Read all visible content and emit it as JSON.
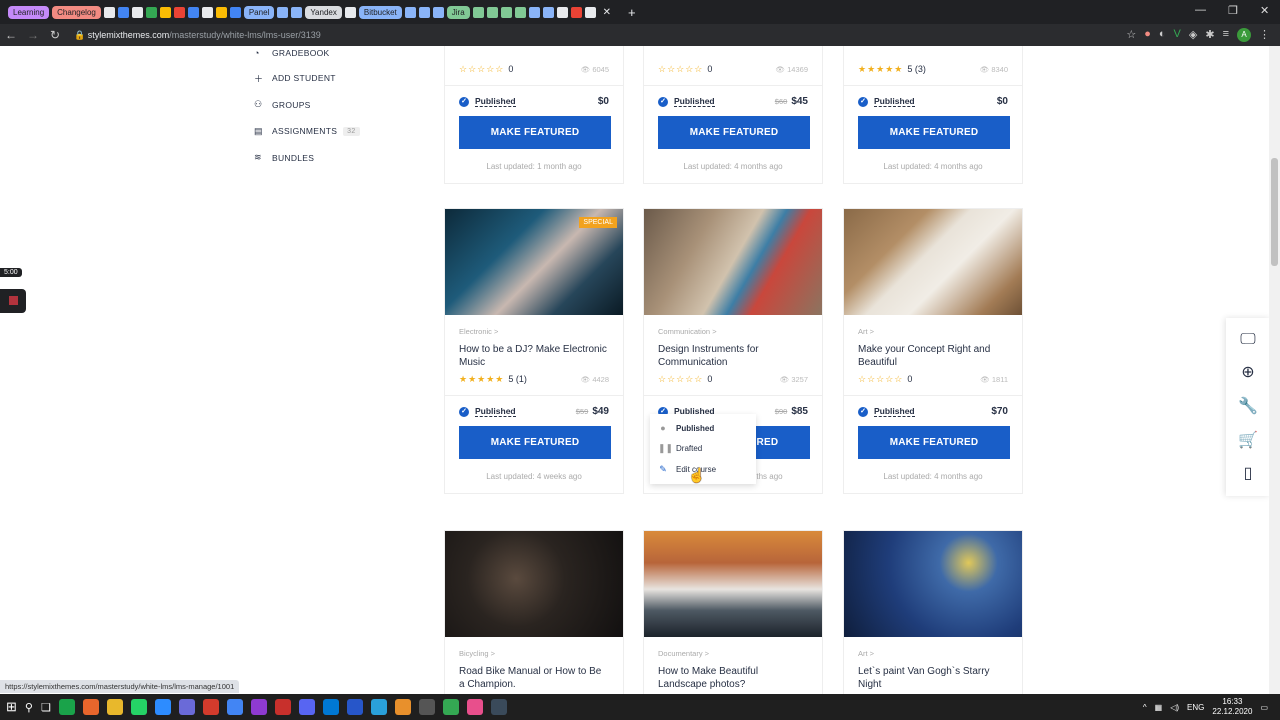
{
  "browser": {
    "tab_groups": [
      "Learning",
      "Changelog",
      "Panel",
      "Yandex",
      "Bitbucket",
      "Jira"
    ],
    "url_host": "stylemixthemes.com",
    "url_path": "/masterstudy/white-lms/lms-user/3139",
    "avatar_letter": "A",
    "status_url": "https://stylemixthemes.com/masterstudy/white-lms/lms-manage/1001"
  },
  "sidebar": {
    "items": [
      {
        "label": "GRADEBOOK",
        "icon": "◔"
      },
      {
        "label": "ADD STUDENT",
        "icon": "👤"
      },
      {
        "label": "GROUPS",
        "icon": "👥"
      },
      {
        "label": "ASSIGNMENTS",
        "icon": "📖",
        "badge": "32"
      },
      {
        "label": "BUNDLES",
        "icon": "≋"
      }
    ]
  },
  "timer": "5:00",
  "row1": [
    {
      "rating": "0",
      "stars": "☆☆☆☆☆",
      "views": "6045",
      "status": "Published",
      "price": "$0",
      "old": "",
      "button": "MAKE FEATURED",
      "updated": "Last updated: 1 month ago"
    },
    {
      "rating": "0",
      "stars": "☆☆☆☆☆",
      "views": "14369",
      "status": "Published",
      "price": "$45",
      "old": "$60",
      "button": "MAKE FEATURED",
      "updated": "Last updated: 4 months ago"
    },
    {
      "rating": "5 (3)",
      "stars": "★★★★★",
      "views": "8340",
      "status": "Published",
      "price": "$0",
      "old": "",
      "button": "MAKE FEATURED",
      "updated": "Last updated: 4 months ago"
    }
  ],
  "row2": [
    {
      "category": "Electronic >",
      "title": "How to be a DJ? Make Electronic Music",
      "rating": "5 (1)",
      "stars": "★★★★★",
      "views": "4428",
      "status": "Published",
      "price": "$49",
      "old": "$59",
      "button": "MAKE FEATURED",
      "updated": "Last updated: 4 weeks ago",
      "badge": "SPECIAL"
    },
    {
      "category": "Communication >",
      "title": "Design Instruments for Communication",
      "rating": "0",
      "stars": "☆☆☆☆☆",
      "views": "3257",
      "status": "Published",
      "price": "$85",
      "old": "$90",
      "button": "MAKE FEATURED",
      "updated": "Last updated: 2 months ago"
    },
    {
      "category": "Art >",
      "title": "Make your Concept Right and Beautiful",
      "rating": "0",
      "stars": "☆☆☆☆☆",
      "views": "1811",
      "status": "Published",
      "price": "$70",
      "old": "",
      "button": "MAKE FEATURED",
      "updated": "Last updated: 4 months ago"
    }
  ],
  "row3": [
    {
      "category": "Bicycling >",
      "title": "Road Bike Manual or How to Be a Champion."
    },
    {
      "category": "Documentary >",
      "title": "How to Make Beautiful Landscape photos?"
    },
    {
      "category": "Art >",
      "title": "Let`s paint Van Gogh`s Starry Night"
    }
  ],
  "dropdown": {
    "items": [
      "Published",
      "Drafted",
      "Edit course"
    ]
  },
  "taskbar": {
    "lang": "ENG",
    "time": "16:33",
    "date": "22.12.2020"
  }
}
